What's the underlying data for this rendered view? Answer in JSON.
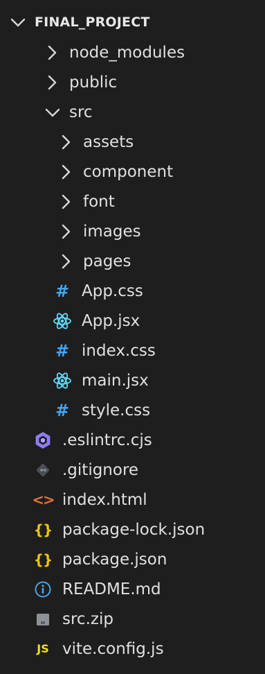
{
  "explorer": {
    "root": {
      "label": "FINAL_PROJECT",
      "expanded": true
    },
    "items": [
      {
        "label": "node_modules",
        "kind": "folder",
        "expanded": false,
        "depth": 1
      },
      {
        "label": "public",
        "kind": "folder",
        "expanded": false,
        "depth": 1
      },
      {
        "label": "src",
        "kind": "folder",
        "expanded": true,
        "depth": 1
      },
      {
        "label": "assets",
        "kind": "folder",
        "expanded": false,
        "depth": 2
      },
      {
        "label": "component",
        "kind": "folder",
        "expanded": false,
        "depth": 2
      },
      {
        "label": "font",
        "kind": "folder",
        "expanded": false,
        "depth": 2
      },
      {
        "label": "images",
        "kind": "folder",
        "expanded": false,
        "depth": 2
      },
      {
        "label": "pages",
        "kind": "folder",
        "expanded": false,
        "depth": 2
      },
      {
        "label": "App.css",
        "kind": "file",
        "icon": "css-hash-icon",
        "depth": 2
      },
      {
        "label": "App.jsx",
        "kind": "file",
        "icon": "react-icon",
        "depth": 2
      },
      {
        "label": "index.css",
        "kind": "file",
        "icon": "css-hash-icon",
        "depth": 2
      },
      {
        "label": "main.jsx",
        "kind": "file",
        "icon": "react-icon",
        "depth": 2
      },
      {
        "label": "style.css",
        "kind": "file",
        "icon": "css-hash-icon",
        "depth": 2
      },
      {
        "label": ".eslintrc.cjs",
        "kind": "file",
        "icon": "eslint-icon",
        "depth": 1
      },
      {
        "label": ".gitignore",
        "kind": "file",
        "icon": "git-icon",
        "depth": 1
      },
      {
        "label": "index.html",
        "kind": "file",
        "icon": "html-icon",
        "depth": 1
      },
      {
        "label": "package-lock.json",
        "kind": "file",
        "icon": "json-icon",
        "depth": 1
      },
      {
        "label": "package.json",
        "kind": "file",
        "icon": "json-icon",
        "depth": 1
      },
      {
        "label": "README.md",
        "kind": "file",
        "icon": "info-icon",
        "depth": 1
      },
      {
        "label": "src.zip",
        "kind": "file",
        "icon": "zip-icon",
        "depth": 1
      },
      {
        "label": "vite.config.js",
        "kind": "file",
        "icon": "js-icon",
        "depth": 1
      }
    ],
    "icon_glyphs": {
      "css": "#",
      "json": "{}",
      "html": "<>",
      "js": "JS"
    },
    "colors": {
      "background": "#1e1e1e",
      "text": "#e0e0e0",
      "css": "#42a5f5",
      "react": "#61dafb",
      "json": "#f1c40f",
      "html": "#e2703a",
      "js": "#f5de19",
      "eslint": "#8e7cf5",
      "info": "#4fa3e6"
    }
  }
}
